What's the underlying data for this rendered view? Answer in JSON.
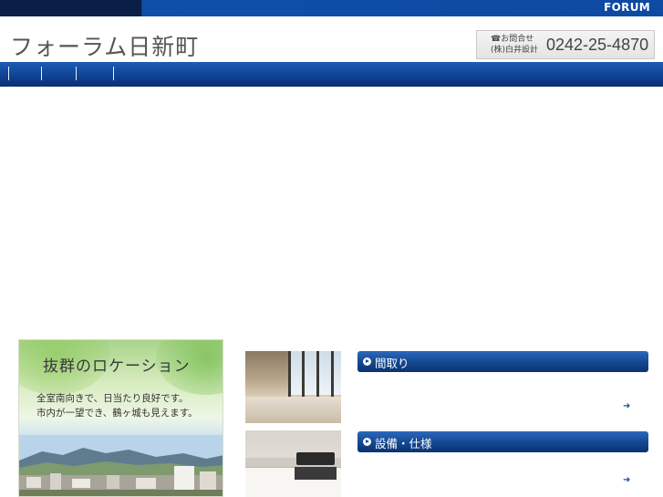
{
  "topbar": {
    "brand": "FORUM"
  },
  "header": {
    "site_title": "フォーラム日新町",
    "contact": {
      "label_line1": "☎お問合せ",
      "label_line2": "(株)白井設計",
      "phone": "0242-25-4870"
    }
  },
  "nav": {
    "separators": 4
  },
  "location_banner": {
    "heading": "抜群のロケーション",
    "desc_line1": "全室南向きで、日当たり良好です。",
    "desc_line2": "市内が一望でき、鶴ヶ城も見えます。"
  },
  "sections": [
    {
      "title": "間取り",
      "more": "➜"
    },
    {
      "title": "設備・仕様",
      "more": "➜"
    }
  ],
  "colors": {
    "nav_blue": "#0f4495",
    "topbar_dark": "#0a1f48",
    "panel_blue": "#13488f"
  }
}
